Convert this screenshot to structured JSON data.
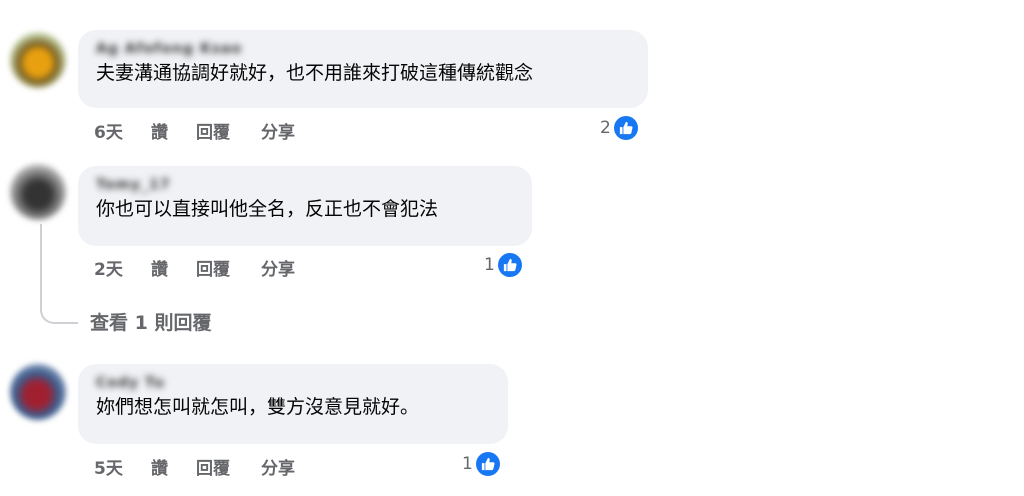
{
  "comments": [
    {
      "name": "Ag Afofong Ksao",
      "text": "夫妻溝通協調好就好，也不用誰來打破這種傳統觀念",
      "time": "6天",
      "like_label": "讚",
      "reply_label": "回覆",
      "share_label": "分享",
      "likes": "2",
      "avatar_color": "#e0a000"
    },
    {
      "name": "Tomy_17",
      "text": "你也可以直接叫他全名，反正也不會犯法",
      "time": "2天",
      "like_label": "讚",
      "reply_label": "回覆",
      "share_label": "分享",
      "likes": "1",
      "view_replies": "查看 1 則回覆",
      "avatar_color": "#555555"
    },
    {
      "name": "Cody Tu",
      "text": "妳們想怎叫就怎叫，雙方沒意見就好。",
      "time": "5天",
      "like_label": "讚",
      "reply_label": "回覆",
      "share_label": "分享",
      "likes": "1",
      "avatar_color": "#3a5a8a"
    }
  ]
}
